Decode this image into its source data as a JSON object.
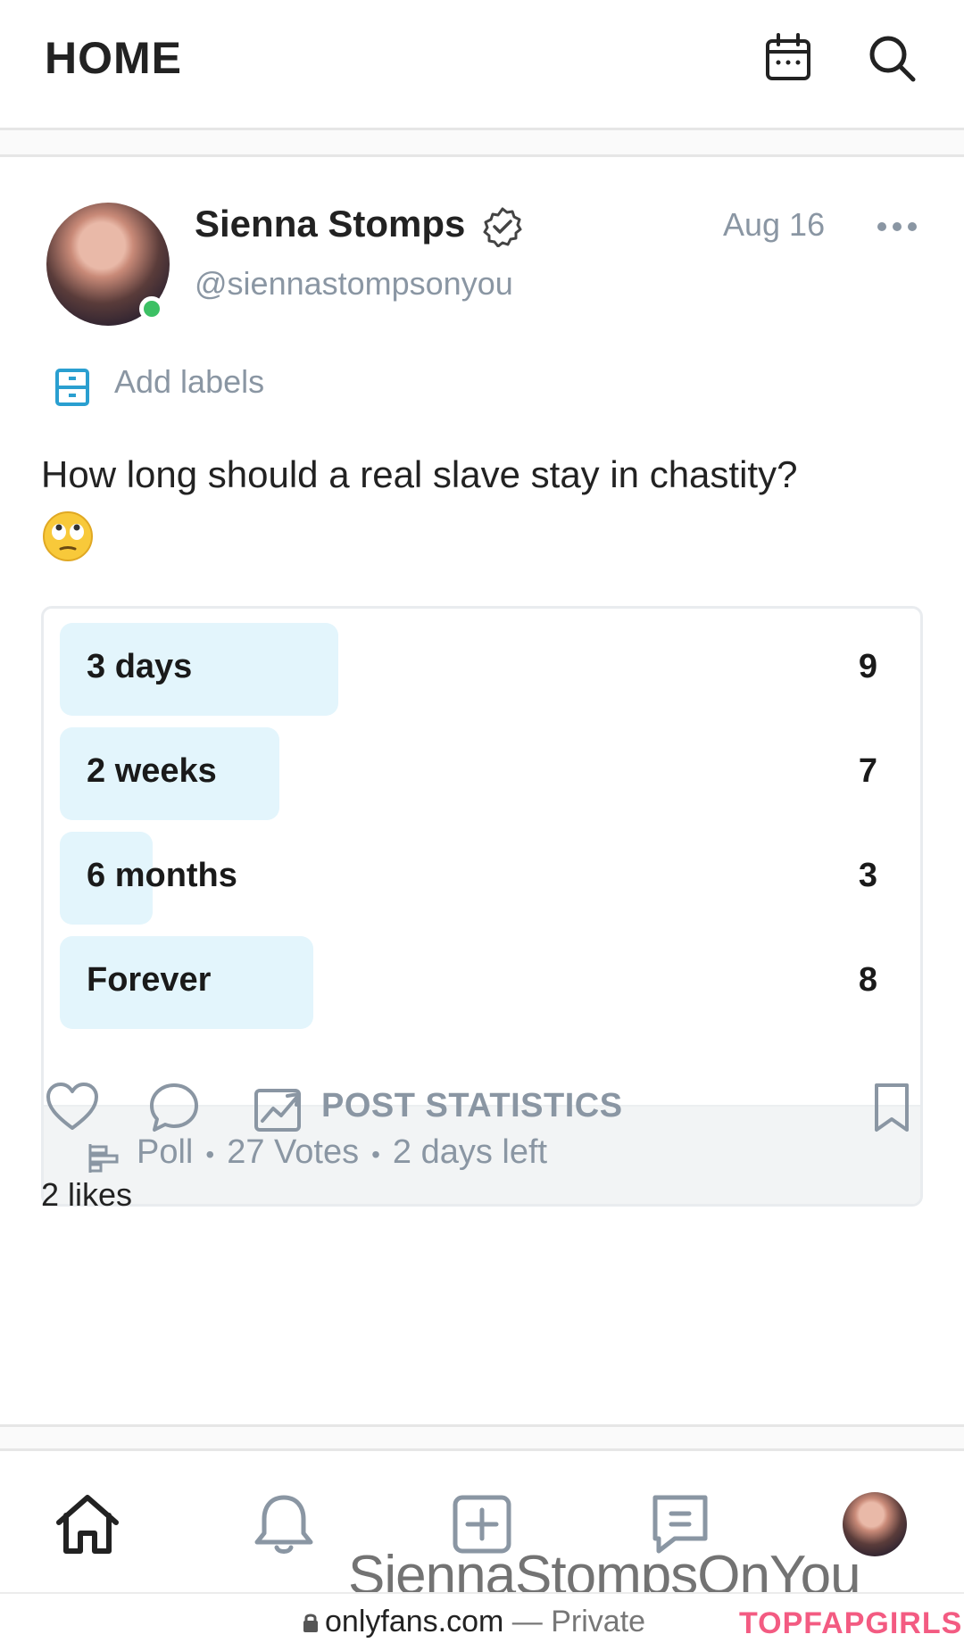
{
  "header": {
    "title": "HOME"
  },
  "post": {
    "author": {
      "name": "Sienna Stomps",
      "handle": "@siennastompsonyou"
    },
    "date": "Aug 16",
    "labels_text": "Add labels",
    "text": "How long should a real slave stay in chastity?",
    "emoji": "rolling-eyes",
    "poll": {
      "options": [
        {
          "label": "3 days",
          "count": "9",
          "share": 0.33
        },
        {
          "label": "2 weeks",
          "count": "7",
          "share": 0.26
        },
        {
          "label": "6 months",
          "count": "3",
          "share": 0.11
        },
        {
          "label": "Forever",
          "count": "8",
          "share": 0.3
        }
      ],
      "meta": {
        "type": "Poll",
        "votes": "27 Votes",
        "time_left": "2 days left"
      }
    },
    "actions": {
      "stats_label": "POST STATISTICS"
    },
    "likes": "2 likes"
  },
  "watermark": "SiennaStompsOnYou",
  "browser": {
    "url": "onlyfans.com",
    "dash": "—",
    "status": "Private"
  },
  "brand_logo": "TOPFAPGIRLS",
  "colors": {
    "poll_fill": "#e3f5fc",
    "muted_text": "#8a96a3",
    "online": "#3cc064",
    "accent": "#00aff0",
    "logo": "#f35b82"
  }
}
